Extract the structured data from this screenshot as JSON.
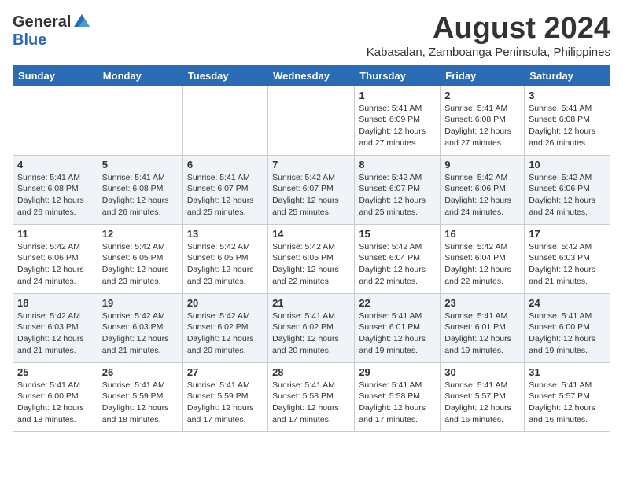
{
  "logo": {
    "general": "General",
    "blue": "Blue"
  },
  "title": {
    "month_year": "August 2024",
    "location": "Kabasalan, Zamboanga Peninsula, Philippines"
  },
  "headers": [
    "Sunday",
    "Monday",
    "Tuesday",
    "Wednesday",
    "Thursday",
    "Friday",
    "Saturday"
  ],
  "weeks": [
    [
      {
        "day": "",
        "info": ""
      },
      {
        "day": "",
        "info": ""
      },
      {
        "day": "",
        "info": ""
      },
      {
        "day": "",
        "info": ""
      },
      {
        "day": "1",
        "info": "Sunrise: 5:41 AM\nSunset: 6:09 PM\nDaylight: 12 hours\nand 27 minutes."
      },
      {
        "day": "2",
        "info": "Sunrise: 5:41 AM\nSunset: 6:08 PM\nDaylight: 12 hours\nand 27 minutes."
      },
      {
        "day": "3",
        "info": "Sunrise: 5:41 AM\nSunset: 6:08 PM\nDaylight: 12 hours\nand 26 minutes."
      }
    ],
    [
      {
        "day": "4",
        "info": "Sunrise: 5:41 AM\nSunset: 6:08 PM\nDaylight: 12 hours\nand 26 minutes."
      },
      {
        "day": "5",
        "info": "Sunrise: 5:41 AM\nSunset: 6:08 PM\nDaylight: 12 hours\nand 26 minutes."
      },
      {
        "day": "6",
        "info": "Sunrise: 5:41 AM\nSunset: 6:07 PM\nDaylight: 12 hours\nand 25 minutes."
      },
      {
        "day": "7",
        "info": "Sunrise: 5:42 AM\nSunset: 6:07 PM\nDaylight: 12 hours\nand 25 minutes."
      },
      {
        "day": "8",
        "info": "Sunrise: 5:42 AM\nSunset: 6:07 PM\nDaylight: 12 hours\nand 25 minutes."
      },
      {
        "day": "9",
        "info": "Sunrise: 5:42 AM\nSunset: 6:06 PM\nDaylight: 12 hours\nand 24 minutes."
      },
      {
        "day": "10",
        "info": "Sunrise: 5:42 AM\nSunset: 6:06 PM\nDaylight: 12 hours\nand 24 minutes."
      }
    ],
    [
      {
        "day": "11",
        "info": "Sunrise: 5:42 AM\nSunset: 6:06 PM\nDaylight: 12 hours\nand 24 minutes."
      },
      {
        "day": "12",
        "info": "Sunrise: 5:42 AM\nSunset: 6:05 PM\nDaylight: 12 hours\nand 23 minutes."
      },
      {
        "day": "13",
        "info": "Sunrise: 5:42 AM\nSunset: 6:05 PM\nDaylight: 12 hours\nand 23 minutes."
      },
      {
        "day": "14",
        "info": "Sunrise: 5:42 AM\nSunset: 6:05 PM\nDaylight: 12 hours\nand 22 minutes."
      },
      {
        "day": "15",
        "info": "Sunrise: 5:42 AM\nSunset: 6:04 PM\nDaylight: 12 hours\nand 22 minutes."
      },
      {
        "day": "16",
        "info": "Sunrise: 5:42 AM\nSunset: 6:04 PM\nDaylight: 12 hours\nand 22 minutes."
      },
      {
        "day": "17",
        "info": "Sunrise: 5:42 AM\nSunset: 6:03 PM\nDaylight: 12 hours\nand 21 minutes."
      }
    ],
    [
      {
        "day": "18",
        "info": "Sunrise: 5:42 AM\nSunset: 6:03 PM\nDaylight: 12 hours\nand 21 minutes."
      },
      {
        "day": "19",
        "info": "Sunrise: 5:42 AM\nSunset: 6:03 PM\nDaylight: 12 hours\nand 21 minutes."
      },
      {
        "day": "20",
        "info": "Sunrise: 5:42 AM\nSunset: 6:02 PM\nDaylight: 12 hours\nand 20 minutes."
      },
      {
        "day": "21",
        "info": "Sunrise: 5:41 AM\nSunset: 6:02 PM\nDaylight: 12 hours\nand 20 minutes."
      },
      {
        "day": "22",
        "info": "Sunrise: 5:41 AM\nSunset: 6:01 PM\nDaylight: 12 hours\nand 19 minutes."
      },
      {
        "day": "23",
        "info": "Sunrise: 5:41 AM\nSunset: 6:01 PM\nDaylight: 12 hours\nand 19 minutes."
      },
      {
        "day": "24",
        "info": "Sunrise: 5:41 AM\nSunset: 6:00 PM\nDaylight: 12 hours\nand 19 minutes."
      }
    ],
    [
      {
        "day": "25",
        "info": "Sunrise: 5:41 AM\nSunset: 6:00 PM\nDaylight: 12 hours\nand 18 minutes."
      },
      {
        "day": "26",
        "info": "Sunrise: 5:41 AM\nSunset: 5:59 PM\nDaylight: 12 hours\nand 18 minutes."
      },
      {
        "day": "27",
        "info": "Sunrise: 5:41 AM\nSunset: 5:59 PM\nDaylight: 12 hours\nand 17 minutes."
      },
      {
        "day": "28",
        "info": "Sunrise: 5:41 AM\nSunset: 5:58 PM\nDaylight: 12 hours\nand 17 minutes."
      },
      {
        "day": "29",
        "info": "Sunrise: 5:41 AM\nSunset: 5:58 PM\nDaylight: 12 hours\nand 17 minutes."
      },
      {
        "day": "30",
        "info": "Sunrise: 5:41 AM\nSunset: 5:57 PM\nDaylight: 12 hours\nand 16 minutes."
      },
      {
        "day": "31",
        "info": "Sunrise: 5:41 AM\nSunset: 5:57 PM\nDaylight: 12 hours\nand 16 minutes."
      }
    ]
  ]
}
